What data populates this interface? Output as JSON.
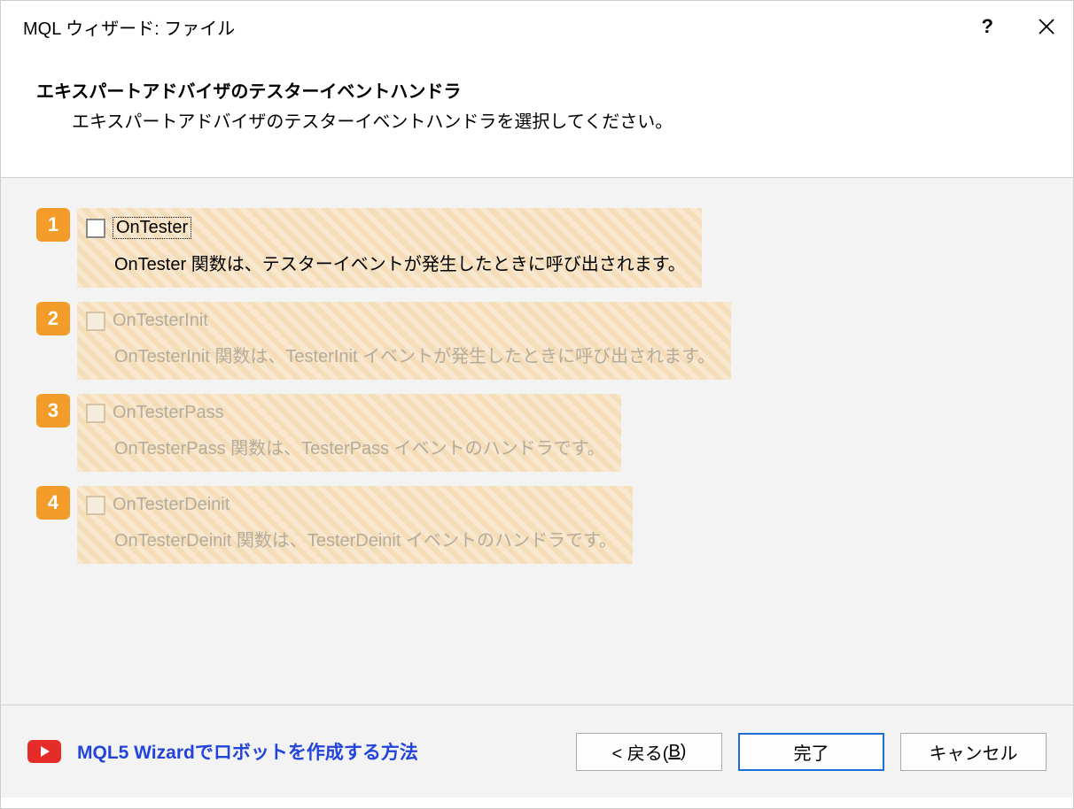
{
  "titlebar": {
    "title": "MQL ウィザード: ファイル",
    "help_symbol": "?"
  },
  "header": {
    "title": "エキスパートアドバイザのテスターイベントハンドラ",
    "subtitle": "エキスパートアドバイザのテスターイベントハンドラを選択してください。"
  },
  "options": [
    {
      "number": "1",
      "label": "OnTester",
      "description": "OnTester 関数は、テスターイベントが発生したときに呼び出されます。",
      "disabled": false,
      "focused": true
    },
    {
      "number": "2",
      "label": "OnTesterInit",
      "description": "OnTesterInit 関数は、TesterInit イベントが発生したときに呼び出されます。",
      "disabled": true,
      "focused": false
    },
    {
      "number": "3",
      "label": "OnTesterPass",
      "description": "OnTesterPass 関数は、TesterPass イベントのハンドラです。",
      "disabled": true,
      "focused": false
    },
    {
      "number": "4",
      "label": "OnTesterDeinit",
      "description": "OnTesterDeinit 関数は、TesterDeinit イベントのハンドラです。",
      "disabled": true,
      "focused": false
    }
  ],
  "footer": {
    "tutorial_text": "MQL5 Wizardでロボットを作成する方法",
    "back_prefix": "< 戻る(",
    "back_key": "B",
    "back_suffix": ")",
    "finish": "完了",
    "cancel": "キャンセル"
  }
}
